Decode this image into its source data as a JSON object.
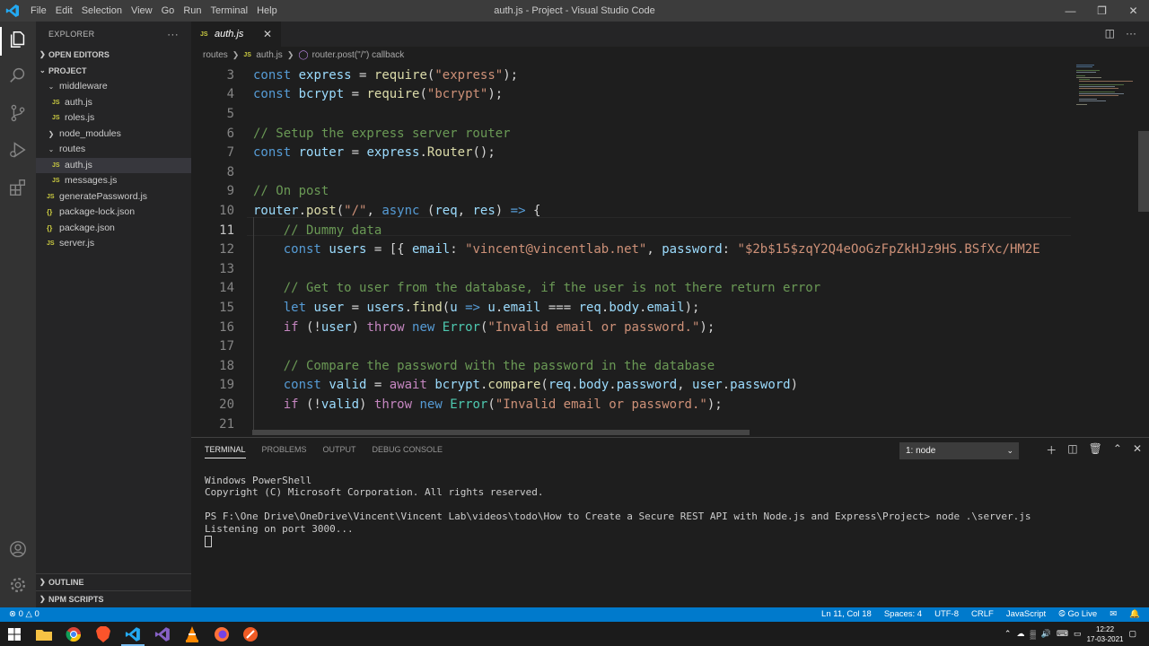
{
  "window": {
    "title": "auth.js - Project - Visual Studio Code",
    "menu": [
      "File",
      "Edit",
      "Selection",
      "View",
      "Go",
      "Run",
      "Terminal",
      "Help"
    ]
  },
  "sidebar": {
    "explorer_label": "EXPLORER",
    "open_editors_label": "OPEN EDITORS",
    "project_label": "PROJECT",
    "tree": [
      {
        "label": "middleware",
        "type": "folder",
        "level": 1
      },
      {
        "label": "auth.js",
        "type": "js",
        "level": 2
      },
      {
        "label": "roles.js",
        "type": "js",
        "level": 2
      },
      {
        "label": "node_modules",
        "type": "folder-closed",
        "level": 1
      },
      {
        "label": "routes",
        "type": "folder",
        "level": 1
      },
      {
        "label": "auth.js",
        "type": "js",
        "level": 2,
        "selected": true
      },
      {
        "label": "messages.js",
        "type": "js",
        "level": 2
      },
      {
        "label": "generatePassword.js",
        "type": "js",
        "level": 1
      },
      {
        "label": "package-lock.json",
        "type": "json",
        "level": 1
      },
      {
        "label": "package.json",
        "type": "json",
        "level": 1
      },
      {
        "label": "server.js",
        "type": "js",
        "level": 1
      }
    ],
    "outline_label": "OUTLINE",
    "npm_scripts_label": "NPM SCRIPTS"
  },
  "editor": {
    "tab_label": "auth.js",
    "breadcrumb": [
      "routes",
      "auth.js",
      "router.post(\"/\") callback"
    ],
    "line_numbers": [
      "3",
      "4",
      "5",
      "6",
      "7",
      "8",
      "9",
      "10",
      "11",
      "12",
      "13",
      "14",
      "15",
      "16",
      "17",
      "18",
      "19",
      "20",
      "21"
    ],
    "current_line": "11"
  },
  "panel": {
    "tabs": [
      "TERMINAL",
      "PROBLEMS",
      "OUTPUT",
      "DEBUG CONSOLE"
    ],
    "terminal_select": "1: node",
    "terminal_lines": [
      "Windows PowerShell",
      "Copyright (C) Microsoft Corporation. All rights reserved.",
      "",
      "PS F:\\One Drive\\OneDrive\\Vincent\\Vincent Lab\\videos\\todo\\How to Create a Secure REST API with Node.js and Express\\Project> node .\\server.js",
      "Listening on port 3000..."
    ]
  },
  "statusbar": {
    "errors": "0",
    "warnings": "0",
    "position": "Ln 11, Col 18",
    "spaces": "Spaces: 4",
    "encoding": "UTF-8",
    "eol": "CRLF",
    "language": "JavaScript",
    "golive": "Go Live"
  },
  "taskbar": {
    "time": "12:22",
    "date": "17-03-2021"
  },
  "colors": {
    "accent": "#007acc",
    "js_badge": "#cbcb41"
  }
}
